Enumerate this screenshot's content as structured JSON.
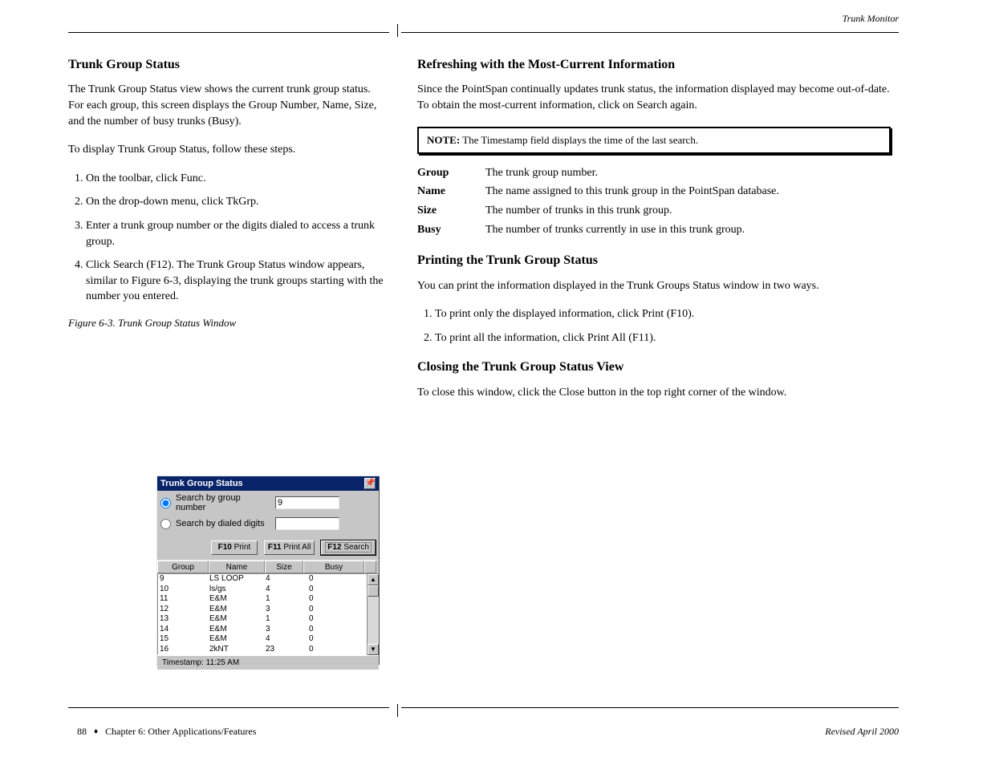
{
  "page": {
    "header_right": "Trunk Monitor",
    "footer_page": "88",
    "footer_chapter": "Chapter 6: Other Applications/Features",
    "footer_right": "Revised April 2000"
  },
  "left": {
    "heading": "Trunk Group Status",
    "p1": "The Trunk Group Status view shows the current trunk group status. For each group, this screen displays the Group Number, Name, Size, and the number of busy trunks (Busy).",
    "p2": "To display Trunk Group Status, follow these steps.",
    "steps": [
      "On the toolbar, click Func.",
      "On the drop-down menu, click TkGrp.",
      "Enter a trunk group number or the digits dialed to access a trunk group.",
      "Click Search (F12). The Trunk Group Status window appears, similar to Figure 6-3, displaying the trunk groups starting with the number you entered."
    ],
    "figure_caption": "Figure 6-3.   Trunk Group Status Window"
  },
  "right": {
    "heading": "Refreshing with the Most-Current Information",
    "p1": "Since the PointSpan continually updates trunk status, the information displayed may become out-of-date. To obtain the most-current information, click on Search again.",
    "note_label": "NOTE:",
    "note_body": "The Timestamp field displays the time of the last search.",
    "fields": [
      {
        "name": "Group",
        "desc": "The trunk group number."
      },
      {
        "name": "Name",
        "desc": "The name assigned to this trunk group in the PointSpan database."
      },
      {
        "name": "Size",
        "desc": "The number of trunks in this trunk group."
      },
      {
        "name": "Busy",
        "desc": "The number of trunks currently in use in this trunk group."
      }
    ],
    "h_print": "Printing the Trunk Group Status",
    "print_intro": "You can print the information displayed in the Trunk Groups Status window in two ways.",
    "print_steps": [
      "To print only the displayed information, click Print (F10).",
      "To print all the information, click Print All (F11)."
    ],
    "h_close": "Closing the Trunk Group Status View",
    "close_p": "To close this window, click the Close button in the top right corner of the window."
  },
  "dialog": {
    "title": "Trunk Group Status",
    "radio1": "Search by group number",
    "radio2": "Search by dialed digits",
    "input1_value": "9",
    "input2_value": "",
    "btn_print_f": "F10",
    "btn_print_t": "Print",
    "btn_printall_f": "F11",
    "btn_printall_t": "Print All",
    "btn_search_f": "F12",
    "btn_search_t": "Search",
    "columns": {
      "c1": "Group",
      "c2": "Name",
      "c3": "Size",
      "c4": "Busy"
    },
    "rows": [
      {
        "group": "9",
        "name": "LS LOOP",
        "size": "4",
        "busy": "0"
      },
      {
        "group": "10",
        "name": "ls/gs",
        "size": "4",
        "busy": "0"
      },
      {
        "group": "11",
        "name": "E&M",
        "size": "1",
        "busy": "0"
      },
      {
        "group": "12",
        "name": "E&M",
        "size": "3",
        "busy": "0"
      },
      {
        "group": "13",
        "name": "E&M",
        "size": "1",
        "busy": "0"
      },
      {
        "group": "14",
        "name": "E&M",
        "size": "3",
        "busy": "0"
      },
      {
        "group": "15",
        "name": "E&M",
        "size": "4",
        "busy": "0"
      },
      {
        "group": "16",
        "name": "2kNT",
        "size": "23",
        "busy": "0"
      }
    ],
    "timestamp": "Timestamp:  11:25 AM"
  }
}
